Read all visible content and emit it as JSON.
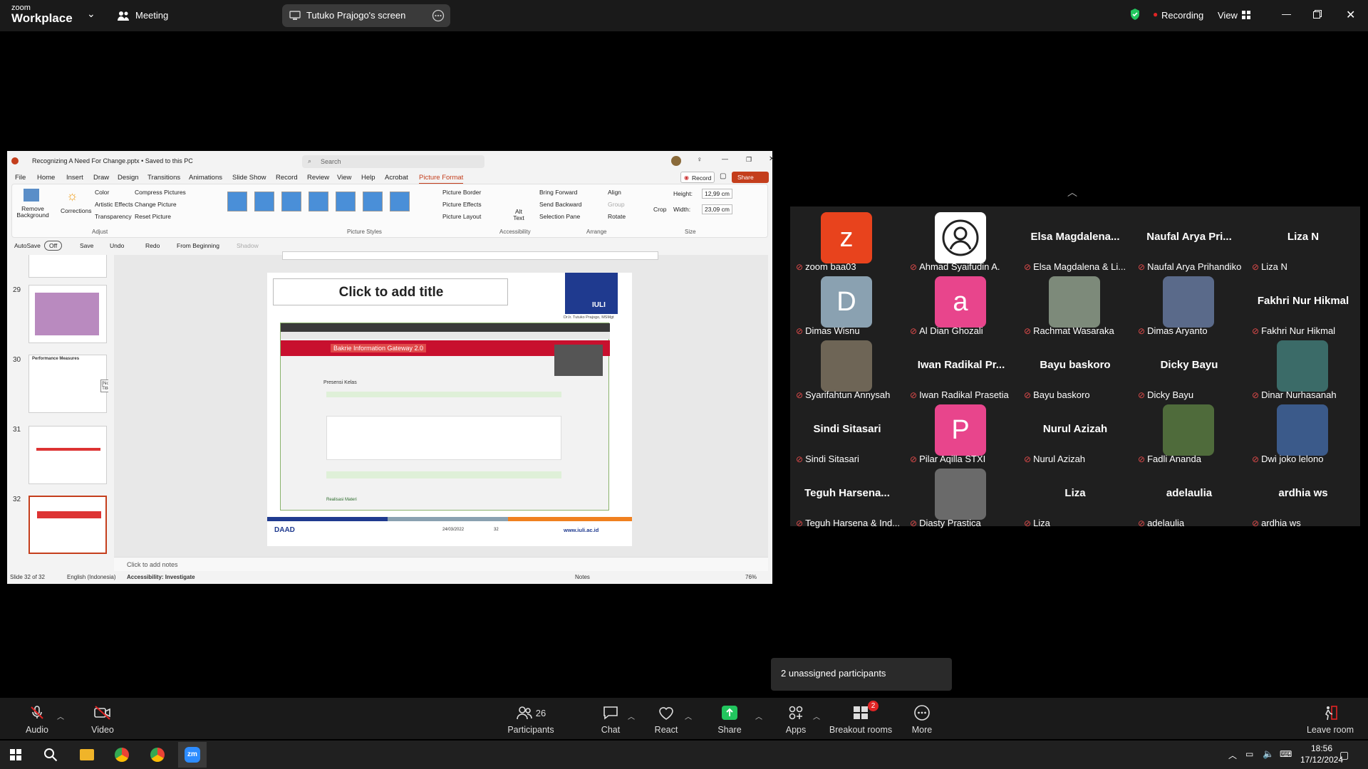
{
  "zoom": {
    "brand_small": "zoom",
    "brand_big": "Workplace",
    "meeting_label": "Meeting",
    "share_label": "Tutuko Prajogo's screen",
    "recording_label": "Recording",
    "view_label": "View"
  },
  "ppt": {
    "file_title": "Recognizing A Need For Change.pptx • Saved to this PC",
    "search_placeholder": "Search",
    "record_label": "Record",
    "share_label": "Share",
    "tabs": [
      "File",
      "Home",
      "Insert",
      "Draw",
      "Design",
      "Transitions",
      "Animations",
      "Slide Show",
      "Record",
      "Review",
      "View",
      "Help",
      "Acrobat",
      "Picture Format"
    ],
    "ribbon": {
      "remove_background": "Remove Background",
      "corrections": "Corrections",
      "color": "Color",
      "artistic_effects": "Artistic Effects",
      "transparency": "Transparency",
      "compress": "Compress Pictures",
      "change_picture": "Change Picture",
      "reset_picture": "Reset Picture",
      "group_adjust": "Adjust",
      "group_styles": "Picture Styles",
      "picture_border": "Picture Border",
      "picture_effects": "Picture Effects",
      "picture_layout": "Picture Layout",
      "alt_text": "Alt Text",
      "group_accessibility": "Accessibility",
      "bring_forward": "Bring Forward",
      "send_backward": "Send Backward",
      "selection_pane": "Selection Pane",
      "align": "Align",
      "group_btn": "Group",
      "rotate": "Rotate",
      "group_arrange": "Arrange",
      "crop": "Crop",
      "height_label": "Height:",
      "height_value": "12,99 cm",
      "width_label": "Width:",
      "width_value": "23,09 cm",
      "group_size": "Size"
    },
    "qat": {
      "autosave": "AutoSave",
      "autosave_state": "Off",
      "save": "Save",
      "undo": "Undo",
      "redo": "Redo",
      "from_beginning": "From Beginning",
      "shadow": "Shadow"
    },
    "slide_numbers": [
      "29",
      "30",
      "31",
      "32"
    ],
    "thumb30_title": "Performance Measures",
    "tooltip": "[No Title]",
    "slide": {
      "title_placeholder": "Click to add title",
      "logo_text": "IULI",
      "author": "Dr.Ir. Tutuko Prajogo, MSMgt",
      "web_title": "Bakrie Information Gateway 2.0",
      "web_section": "Presensi Kelas",
      "web_footer_label": "Realisasi Materi",
      "footer_daad": "DAAD",
      "footer_date": "24/03/2022",
      "footer_page": "32",
      "footer_url": "www.iuli.ac.id"
    },
    "notes_placeholder": "Click to add notes",
    "status": {
      "slide_of": "Slide 32 of 32",
      "language": "English (Indonesia)",
      "accessibility": "Accessibility: Investigate",
      "notes": "Notes",
      "zoom": "76%"
    }
  },
  "participants": [
    {
      "label": "zoom baa03",
      "avatar": "z",
      "color": "#e8431d"
    },
    {
      "label": "Ahmad Syaifudin A.",
      "avatar": "photo",
      "color": "#ffffff"
    },
    {
      "label": "Elsa Magdalena & Li...",
      "bigname": "Elsa  Magdalena..."
    },
    {
      "label": "Naufal Arya Prihandiko",
      "bigname": "Naufal Arya Pri..."
    },
    {
      "label": "Liza N",
      "bigname": "Liza N"
    },
    {
      "label": "Dimas Wisnu",
      "avatar": "D",
      "color": "#8aa1b1"
    },
    {
      "label": "Al Dian Ghozali",
      "avatar": "a",
      "color": "#e8458c"
    },
    {
      "label": "Rachmat Wasaraka",
      "avatar": "photo",
      "color": "#7d8a7a"
    },
    {
      "label": "Dimas Aryanto",
      "avatar": "photo",
      "color": "#5a6a8a"
    },
    {
      "label": "Fakhri Nur Hikmal",
      "bigname": "Fakhri Nur Hikmal"
    },
    {
      "label": "Syarifahtun Annysah",
      "avatar": "photo",
      "color": "#6e6556"
    },
    {
      "label": "Iwan Radikal Prasetia",
      "bigname": "Iwan Radikal Pr..."
    },
    {
      "label": "Bayu baskoro",
      "bigname": "Bayu baskoro"
    },
    {
      "label": "Dicky Bayu",
      "bigname": "Dicky Bayu"
    },
    {
      "label": "Dinar Nurhasanah",
      "avatar": "photo",
      "color": "#3b6b68"
    },
    {
      "label": "Sindi Sitasari",
      "bigname": "Sindi Sitasari"
    },
    {
      "label": "Pilar Aqilla STXI",
      "avatar": "P",
      "color": "#e8458c"
    },
    {
      "label": "Nurul Azizah",
      "bigname": "Nurul Azizah"
    },
    {
      "label": "Fadli Ananda",
      "avatar": "photo",
      "color": "#4f6b3b"
    },
    {
      "label": "Dwi joko lelono",
      "avatar": "photo",
      "color": "#3b5a8a"
    },
    {
      "label": "Teguh Harsena & Ind...",
      "bigname": "Teguh  Harsena..."
    },
    {
      "label": "Diasty Prastica",
      "avatar": "photo",
      "color": "#6a6a6a"
    },
    {
      "label": "Liza",
      "bigname": "Liza"
    },
    {
      "label": "adelaulia",
      "bigname": "adelaulia"
    },
    {
      "label": "ardhia ws",
      "bigname": "ardhia ws"
    }
  ],
  "unassigned": "2 unassigned participants",
  "toolbar": {
    "audio": "Audio",
    "video": "Video",
    "participants": "Participants",
    "participants_count": "26",
    "chat": "Chat",
    "react": "React",
    "share": "Share",
    "apps": "Apps",
    "breakout": "Breakout rooms",
    "breakout_badge": "2",
    "more": "More",
    "leave": "Leave room"
  },
  "taskbar": {
    "time": "18:56",
    "date": "17/12/2024"
  },
  "colors": {
    "ppt_accent": "#c43e1c",
    "zoom_green": "#22c55e",
    "recording_red": "#e02424",
    "mute_red": "#e04a4a"
  }
}
